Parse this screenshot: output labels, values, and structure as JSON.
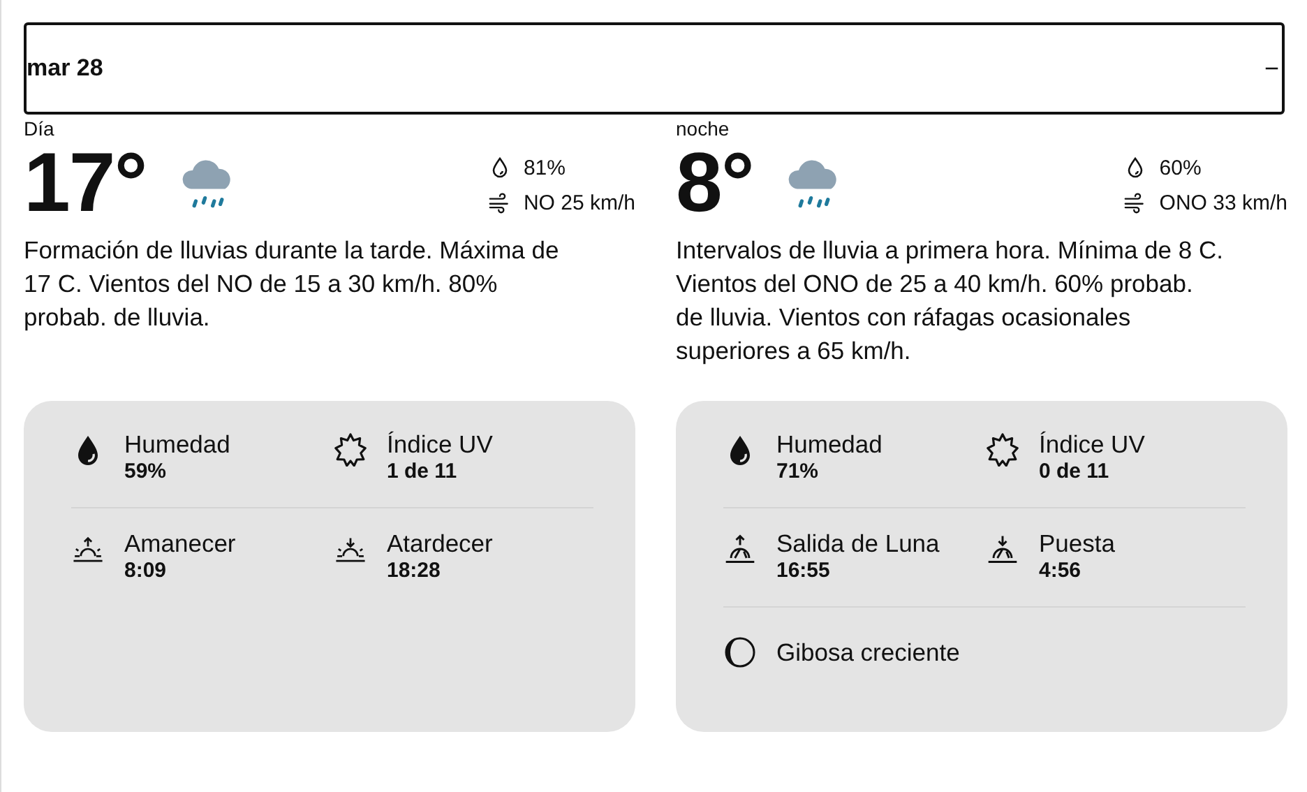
{
  "header": {
    "date": "mar 28",
    "toggle": "−"
  },
  "periods": [
    {
      "label": "Día",
      "temperature": "17°",
      "kind": "rain",
      "precipitation": "81%",
      "wind": "NO 25 km/h",
      "description": "Formación de lluvias durante la tarde. Máxima de 17 C. Vientos del NO de 15 a 30 km/h. 80% probab. de lluvia.",
      "details": [
        [
          {
            "kind": "humidity",
            "label": "Humedad",
            "value": "59%"
          },
          {
            "kind": "uv",
            "label": "Índice UV",
            "value": "1 de 11"
          }
        ],
        [
          {
            "kind": "sunrise",
            "label": "Amanecer",
            "value": "8:09"
          },
          {
            "kind": "sunset",
            "label": "Atardecer",
            "value": "18:28"
          }
        ]
      ]
    },
    {
      "label": "noche",
      "temperature": "8°",
      "kind": "rain",
      "precipitation": "60%",
      "wind": "ONO 33 km/h",
      "description": "Intervalos de lluvia a primera hora. Mínima de 8 C. Vientos del ONO de 25 a 40 km/h. 60% probab. de lluvia. Vientos con ráfagas ocasionales superiores a 65 km/h.",
      "details": [
        [
          {
            "kind": "humidity",
            "label": "Humedad",
            "value": "71%"
          },
          {
            "kind": "uv",
            "label": "Índice UV",
            "value": "0 de 11"
          }
        ],
        [
          {
            "kind": "moonrise",
            "label": "Salida de Luna",
            "value": "16:55"
          },
          {
            "kind": "moonset",
            "label": "Puesta",
            "value": "4:56"
          }
        ]
      ],
      "moon_phase": {
        "kind": "waxing_gibbous",
        "label": "Gibosa creciente"
      }
    }
  ]
}
